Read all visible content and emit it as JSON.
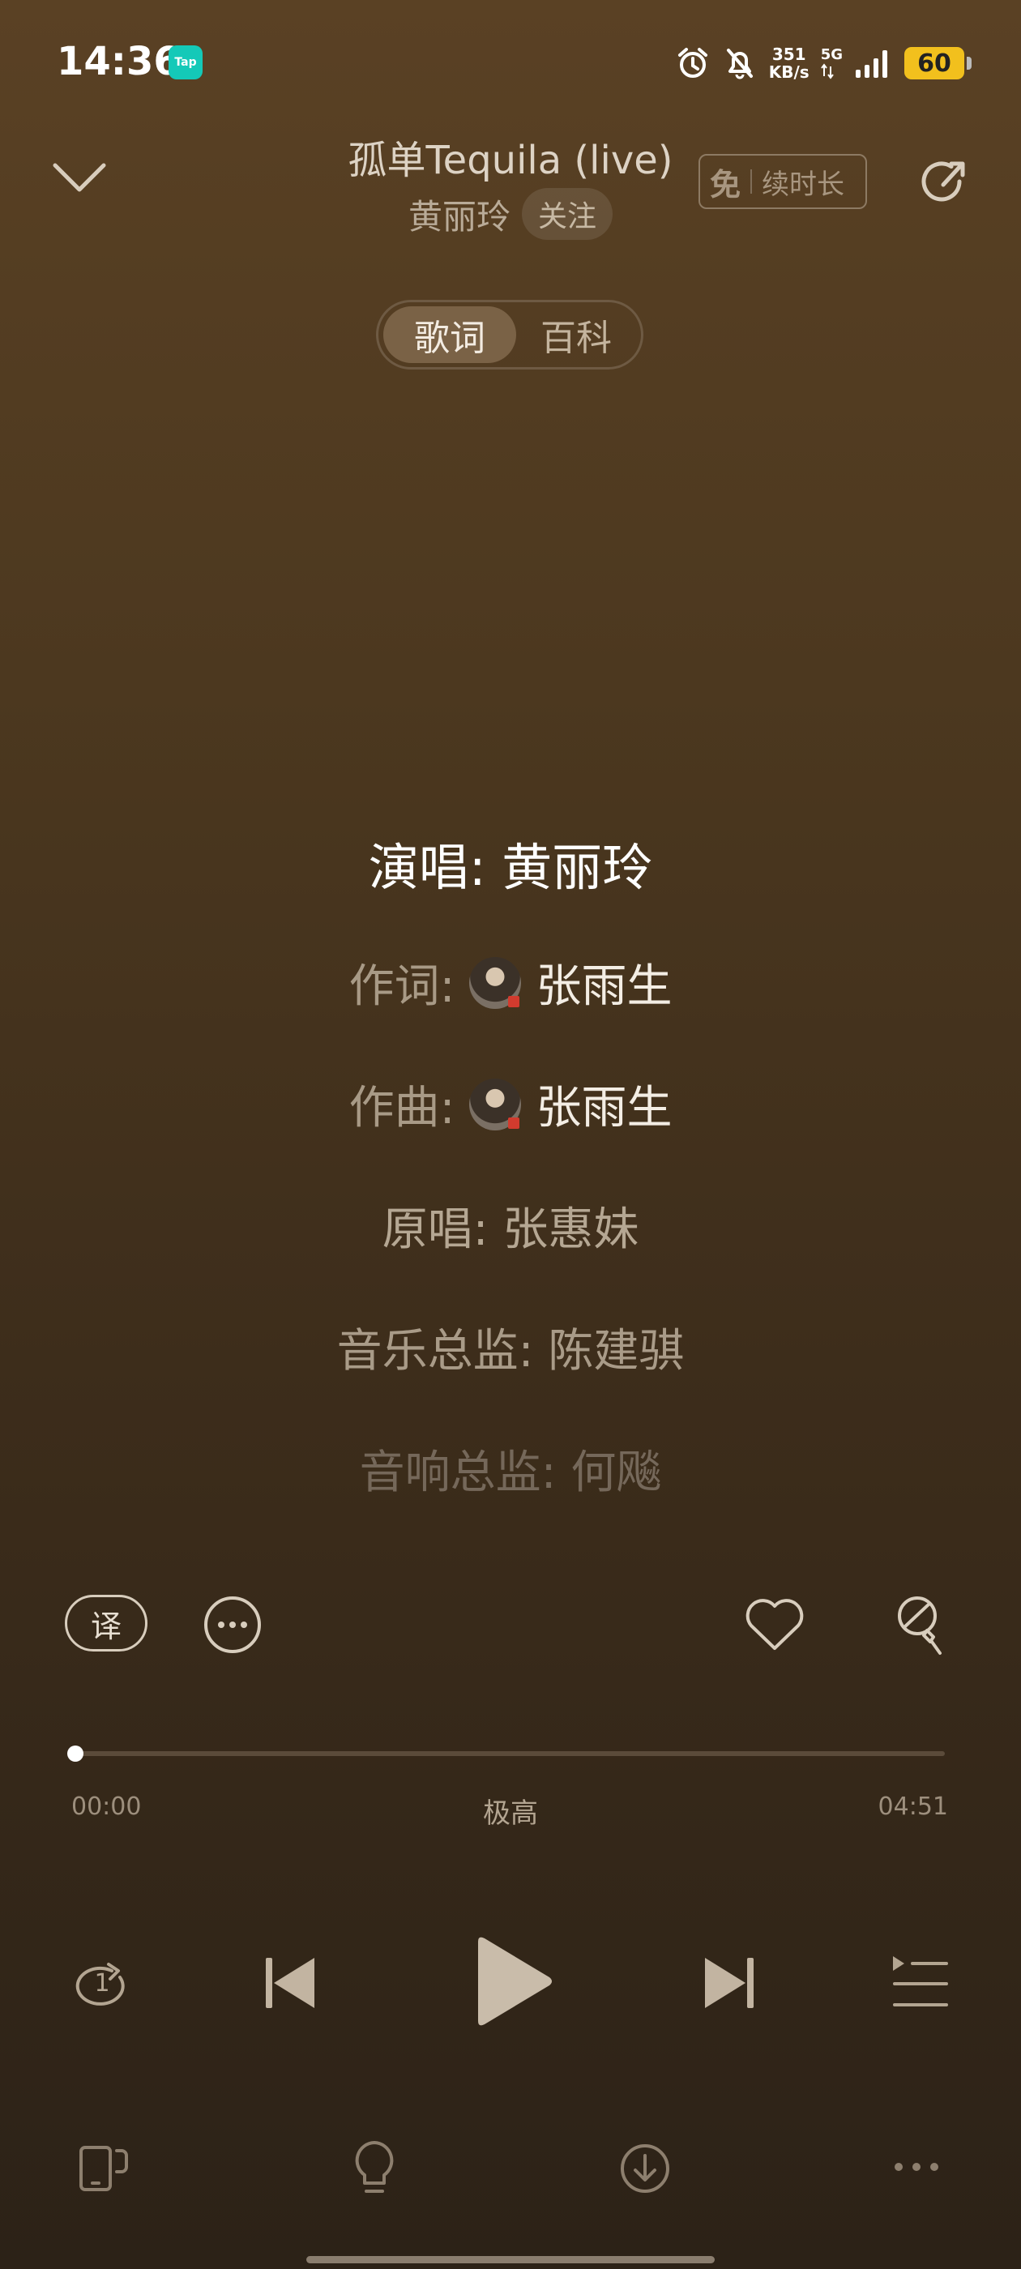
{
  "status_bar": {
    "time": "14:36",
    "app_badge": "Tap",
    "net_speed_value": "351",
    "net_speed_unit": "KB/s",
    "network": "5G",
    "battery": "60"
  },
  "header": {
    "title": "孤单Tequila (live)",
    "artist": "黄丽玲",
    "follow_label": "关注",
    "vip_free": "免",
    "vip_label": "续时长"
  },
  "tabs": [
    {
      "label": "歌词",
      "active": true
    },
    {
      "label": "百科",
      "active": false
    }
  ],
  "lyrics": {
    "line1": "演唱: 黄丽玲",
    "line2_label": "作词:",
    "line2_name": "张雨生",
    "line3_label": "作曲:",
    "line3_name": "张雨生",
    "line4": "原唱: 张惠妹",
    "line5": "音乐总监: 陈建骐",
    "line6": "音响总监: 何飚"
  },
  "actions": {
    "translate_label": "译"
  },
  "progress": {
    "current": "00:00",
    "quality": "极高",
    "total": "04:51",
    "fraction": 0.0
  },
  "controls": {
    "repeat_count": "1"
  },
  "colors": {
    "background_top": "#5a4124",
    "background_bottom": "#2c2217",
    "battery": "#f2c01d",
    "tap_badge": "#14c9b8"
  }
}
